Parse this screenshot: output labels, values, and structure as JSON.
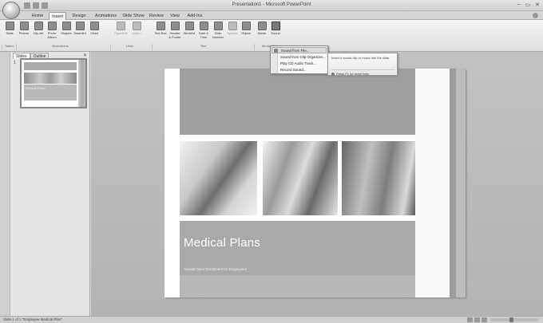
{
  "window": {
    "title": "Presentation1 - Microsoft PowerPoint",
    "controls": [
      "–",
      "▭",
      "✕"
    ]
  },
  "tabs": [
    "Home",
    "Insert",
    "Design",
    "Animations",
    "Slide Show",
    "Review",
    "View",
    "Add-Ins"
  ],
  "active_tab": "Insert",
  "ribbon": {
    "buttons": [
      {
        "label": "Table",
        "state": "normal"
      },
      {
        "label": "Picture",
        "state": "normal"
      },
      {
        "label": "Clip Art",
        "state": "normal"
      },
      {
        "label": "Photo Album",
        "state": "normal"
      },
      {
        "label": "Shapes",
        "state": "normal"
      },
      {
        "label": "SmartArt",
        "state": "normal"
      },
      {
        "label": "Chart",
        "state": "normal"
      },
      {
        "label": "Hyperlink",
        "state": "disabled"
      },
      {
        "label": "Action",
        "state": "disabled"
      },
      {
        "label": "Text Box",
        "state": "normal"
      },
      {
        "label": "Header & Footer",
        "state": "normal"
      },
      {
        "label": "WordArt",
        "state": "normal"
      },
      {
        "label": "Date & Time",
        "state": "normal"
      },
      {
        "label": "Slide Number",
        "state": "normal"
      },
      {
        "label": "Symbol",
        "state": "disabled"
      },
      {
        "label": "Object",
        "state": "normal"
      },
      {
        "label": "Movie",
        "state": "normal"
      },
      {
        "label": "Sound",
        "state": "active"
      }
    ],
    "groups": [
      "Tables",
      "Illustrations",
      "Links",
      "Text",
      "Media Clips"
    ]
  },
  "outline_pane": {
    "tabs": [
      "Slides",
      "Outline"
    ],
    "close": "✕",
    "slide_number": "1"
  },
  "thumbnail": {
    "title": "Medical Plans"
  },
  "slide": {
    "title": "Medical Plans",
    "subtitle": "Annual Open Enrollment for Employees",
    "photos": [
      "senior-couple-with-doctor-photo",
      "doctor-with-boy-photo",
      "young-man-with-stethoscope-photo"
    ]
  },
  "sound_menu": {
    "items": [
      "Sound from File...",
      "Sound from Clip Organizer...",
      "Play CD Audio Track...",
      "Record Sound..."
    ],
    "highlighted": "Sound from File..."
  },
  "tooltip": {
    "description": "Insert a sound clip or music into the slide.",
    "help": "Press F1 for more help."
  },
  "status": {
    "text": "Slide 1 of 1   \"Employee Medical Plan\""
  }
}
